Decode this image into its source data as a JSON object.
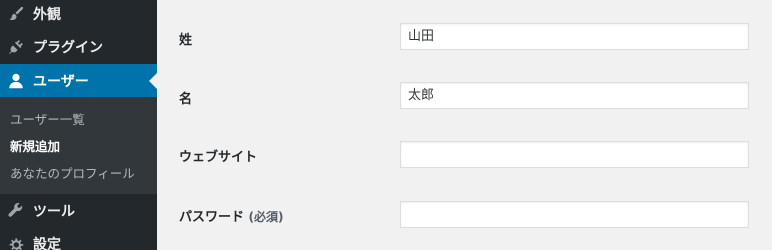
{
  "sidebar": {
    "items": [
      {
        "label": "外観",
        "icon": "paintbrush-icon"
      },
      {
        "label": "プラグイン",
        "icon": "plugin-icon"
      },
      {
        "label": "ユーザー",
        "icon": "user-icon",
        "active": true
      },
      {
        "label": "ツール",
        "icon": "wrench-icon"
      },
      {
        "label": "設定",
        "icon": "settings-icon"
      }
    ],
    "submenu": [
      {
        "label": "ユーザー一覧"
      },
      {
        "label": "新規追加",
        "current": true
      },
      {
        "label": "あなたのプロフィール"
      }
    ],
    "active_color": "#0073aa"
  },
  "form": {
    "last_name_label": "姓",
    "last_name_value": "山田",
    "first_name_label": "名",
    "first_name_value": "太郎",
    "website_label": "ウェブサイト",
    "website_value": "",
    "password_label": "パスワード",
    "password_required": "(必須)",
    "password_value": ""
  }
}
